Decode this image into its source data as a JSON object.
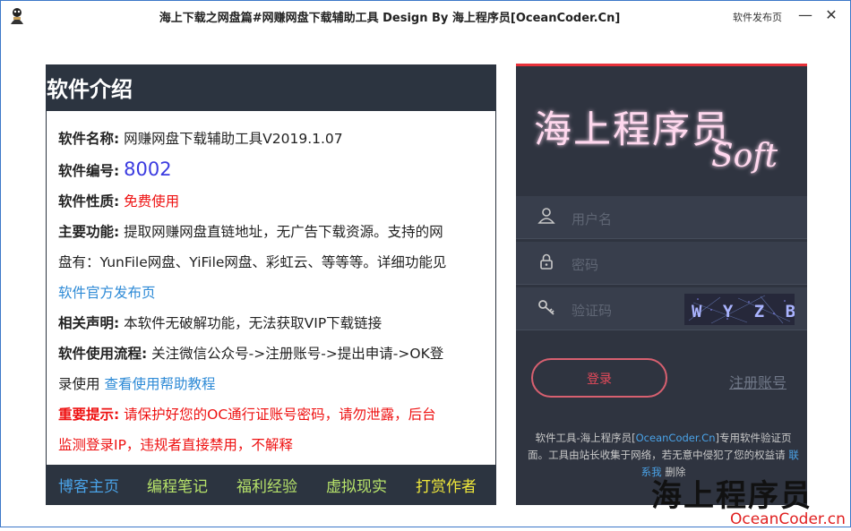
{
  "window": {
    "title": "海上下载之网盘篇#网赚网盘下载辅助工具 Design By 海上程序员[OceanCoder.Cn]",
    "title_link": "软件发布页",
    "minimize": "—",
    "close": "✕"
  },
  "intro": {
    "heading": "软件介绍",
    "name_label": "软件名称:",
    "name_value": "网赚网盘下载辅助工具V2019.1.07",
    "id_label": "软件编号:",
    "id_value": "8002",
    "nature_label": "软件性质:",
    "nature_value": "免费使用",
    "func_label": "主要功能:",
    "func_text_1": "提取网赚网盘直链地址，无广告下载资源。支持的网",
    "func_text_2": "盘有：YunFile网盘、YiFile网盘、彩虹云、等等等。详细功能见",
    "func_link": "软件官方发布页",
    "declare_label": "相关声明:",
    "declare_value": "本软件无破解功能，无法获取VIP下载链接",
    "flow_label": "软件使用流程:",
    "flow_value": "关注微信公众号->注册账号->提出申请->OK登",
    "flow_value_2": "录使用",
    "flow_link": "查看使用帮助教程",
    "warn_label": "重要提示:",
    "warn_value": "请保护好您的OC通行证账号密码，请勿泄露，后台",
    "warn_value_2": "监测登录IP，违规者直接禁用，不解释"
  },
  "footer_links": [
    {
      "label": "博客主页",
      "color": "#4aa3e8"
    },
    {
      "label": "编程笔记",
      "color": "#b7e36a"
    },
    {
      "label": "福利经验",
      "color": "#b7e36a"
    },
    {
      "label": "虚拟现实",
      "color": "#b7e36a"
    },
    {
      "label": "打赏作者",
      "color": "#f0e83a"
    }
  ],
  "login": {
    "logo_text": "海上程序员",
    "logo_soft": "Soft",
    "username_placeholder": "用户名",
    "password_placeholder": "密码",
    "captcha_placeholder": "验证码",
    "captcha_text": "W Y Z B",
    "login_button": "登录",
    "register_link": "注册账号",
    "notice_1": "软件工具-海上程序员[",
    "notice_site": "OceanCoder.Cn",
    "notice_2": "]专用软件验证页面。工具由站长收集于网络，若无意中侵犯了您的权益请",
    "notice_contact": "联系我",
    "notice_3": "删除"
  },
  "brand": {
    "text": "海上程序员",
    "domain": "OceanCoder.cn"
  },
  "colors": {
    "accent_red": "#e8313a",
    "dark_panel": "#2c3440"
  }
}
